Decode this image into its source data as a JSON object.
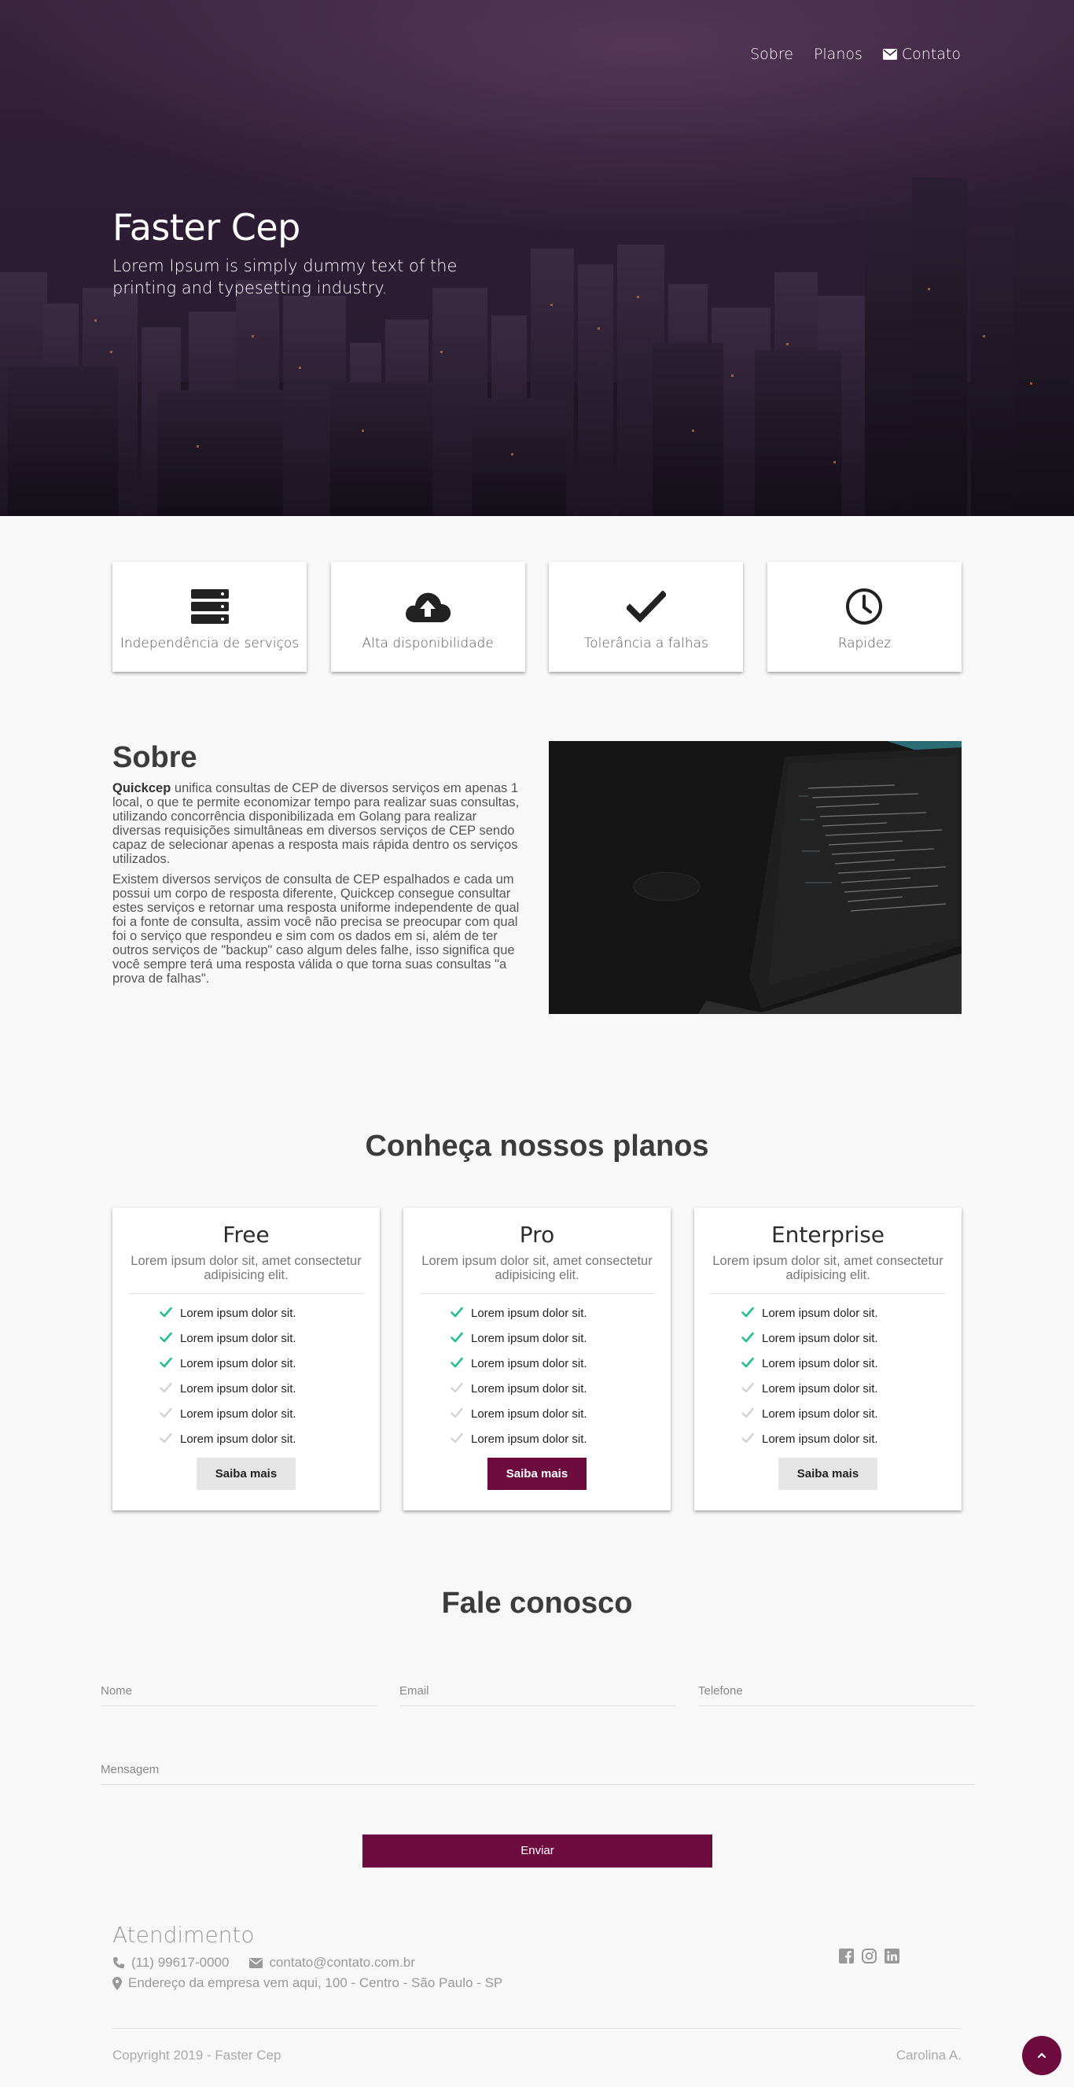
{
  "nav": {
    "items": [
      "Sobre",
      "Planos",
      "Contato"
    ]
  },
  "hero": {
    "title": "Faster Cep",
    "subtitle": "Lorem Ipsum is simply dummy text of the printing and typesetting industry."
  },
  "features": [
    {
      "label": "Independência de serviços",
      "icon": "server-icon"
    },
    {
      "label": "Alta disponibilidade",
      "icon": "cloud-upload-icon"
    },
    {
      "label": "Tolerância a falhas",
      "icon": "check-icon"
    },
    {
      "label": "Rapidez",
      "icon": "clock-icon"
    }
  ],
  "about": {
    "title": "Sobre",
    "brand": "Quickcep",
    "p1": "unifica consultas de CEP de diversos serviços em apenas 1 local, o que te permite economizar tempo para realizar suas consultas, utilizando concorrência disponibilizada em Golang para realizar diversas requisições simultâneas em diversos serviços de CEP sendo capaz de selecionar apenas a resposta mais rápida dentro os serviços utilizados.",
    "p2": "Existem diversos serviços de consulta de CEP espalhados e cada um possui um corpo de resposta diferente, Quickcep consegue consultar estes serviços e retornar uma resposta uniforme independente de qual foi a fonte de consulta, assim você não precisa se preocupar com qual foi o serviço que respondeu e sim com os dados em si, além de ter outros serviços de \"backup\" caso algum deles falhe, isso significa que você sempre terá uma resposta válida o que torna suas consultas \"a prova de falhas\"."
  },
  "plans": {
    "title": "Conheça nossos planos",
    "items": [
      {
        "name": "Free",
        "desc": "Lorem ipsum dolor sit, amet consectetur adipisicing elit.",
        "button": "Saiba mais",
        "features": [
          "Lorem ipsum dolor sit.",
          "Lorem ipsum dolor sit.",
          "Lorem ipsum dolor sit.",
          "Lorem ipsum dolor sit.",
          "Lorem ipsum dolor sit.",
          "Lorem ipsum dolor sit."
        ]
      },
      {
        "name": "Pro",
        "desc": "Lorem ipsum dolor sit, amet consectetur adipisicing elit.",
        "button": "Saiba mais",
        "features": [
          "Lorem ipsum dolor sit.",
          "Lorem ipsum dolor sit.",
          "Lorem ipsum dolor sit.",
          "Lorem ipsum dolor sit.",
          "Lorem ipsum dolor sit.",
          "Lorem ipsum dolor sit."
        ]
      },
      {
        "name": "Enterprise",
        "desc": "Lorem ipsum dolor sit, amet consectetur adipisicing elit.",
        "button": "Saiba mais",
        "features": [
          "Lorem ipsum dolor sit.",
          "Lorem ipsum dolor sit.",
          "Lorem ipsum dolor sit.",
          "Lorem ipsum dolor sit.",
          "Lorem ipsum dolor sit.",
          "Lorem ipsum dolor sit."
        ]
      }
    ],
    "included_count": 3
  },
  "contact": {
    "title": "Fale conosco",
    "name_placeholder": "Nome",
    "email_placeholder": "Email",
    "phone_placeholder": "Telefone",
    "message_placeholder": "Mensagem",
    "send_label": "Enviar"
  },
  "footer": {
    "title": "Atendimento",
    "phone": "(11) 99617-0000",
    "email": "contato@contato.com.br",
    "address": "Endereço da empresa vem aqui, 100 - Centro - São Paulo - SP",
    "socials": [
      "facebook-icon",
      "instagram-icon",
      "linkedin-icon"
    ],
    "copyright": "Copyright 2019 - Faster Cep",
    "author": "Carolina A."
  },
  "colors": {
    "accent": "#6e0b3e",
    "check_active": "#1fbf8f",
    "check_inactive": "#d5d5d5"
  }
}
